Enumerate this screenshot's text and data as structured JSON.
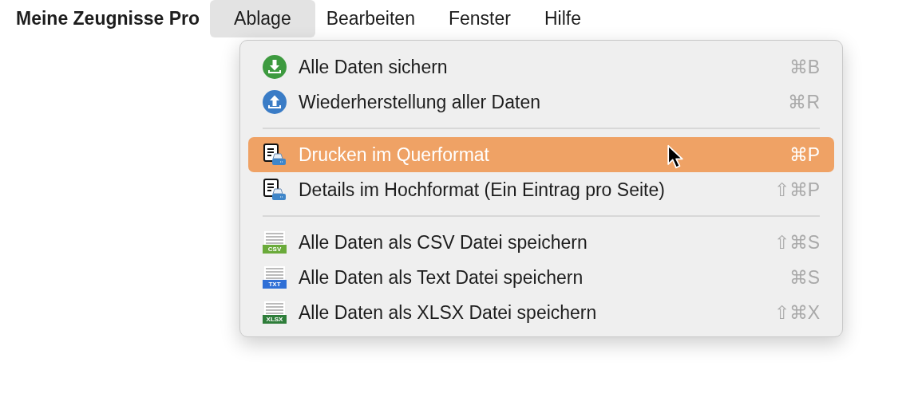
{
  "menu_bar": {
    "app_name": "Meine Zeugnisse Pro",
    "menus": [
      {
        "label": "Ablage",
        "selected": true
      },
      {
        "label": "Bearbeiten",
        "selected": false
      },
      {
        "label": "Fenster",
        "selected": false
      },
      {
        "label": "Hilfe",
        "selected": false
      }
    ]
  },
  "dropdown": {
    "items": [
      {
        "kind": "item",
        "icon": {
          "kind": "download",
          "color": "#3d9a3f"
        },
        "label": "Alle Daten sichern",
        "shortcut": "⌘B",
        "selected": false
      },
      {
        "kind": "item",
        "icon": {
          "kind": "upload",
          "color": "#3a7cc6"
        },
        "label": "Wiederherstellung aller Daten",
        "shortcut": "⌘R",
        "selected": false
      },
      {
        "kind": "separator"
      },
      {
        "kind": "item",
        "icon": {
          "kind": "print"
        },
        "label": "Drucken im Querformat",
        "shortcut": "⌘P",
        "selected": true
      },
      {
        "kind": "item",
        "icon": {
          "kind": "print"
        },
        "label": "Details im Hochformat (Ein Eintrag pro Seite)",
        "shortcut": "⇧⌘P",
        "selected": false
      },
      {
        "kind": "separator"
      },
      {
        "kind": "item",
        "icon": {
          "kind": "file",
          "badge": "CSV",
          "color": "#6aaa3a"
        },
        "label": "Alle Daten als CSV Datei speichern",
        "shortcut": "⇧⌘S",
        "selected": false
      },
      {
        "kind": "item",
        "icon": {
          "kind": "file",
          "badge": "TXT",
          "color": "#2f6fd6"
        },
        "label": "Alle Daten als Text Datei speichern",
        "shortcut": "⌘S",
        "selected": false
      },
      {
        "kind": "item",
        "icon": {
          "kind": "file",
          "badge": "XLSX",
          "color": "#2e7d3a"
        },
        "label": "Alle Daten als XLSX Datei speichern",
        "shortcut": "⇧⌘X",
        "selected": false
      }
    ]
  }
}
